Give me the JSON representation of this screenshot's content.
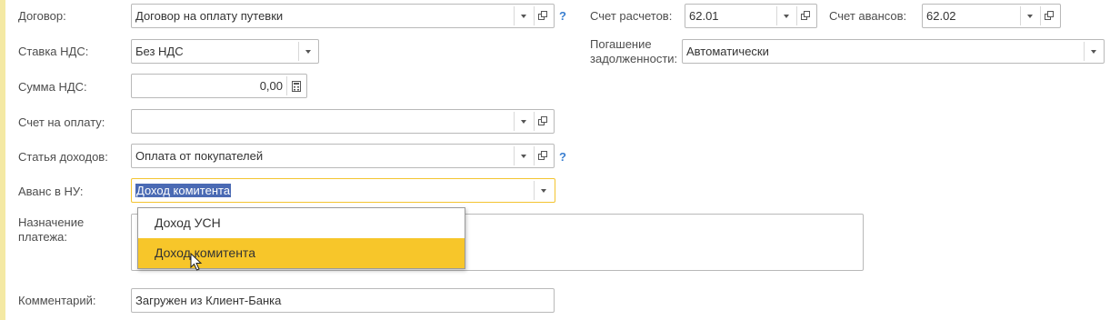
{
  "labels": {
    "contract": "Договор:",
    "vat_rate": "Ставка НДС:",
    "vat_sum": "Сумма НДС:",
    "invoice": "Счет на оплату:",
    "income_item": "Статья доходов:",
    "advance_nu": "Аванс в НУ:",
    "purpose": "Назначение платежа:",
    "comment": "Комментарий:",
    "settlement_account": "Счет расчетов:",
    "advance_account": "Счет авансов:",
    "debt_repayment": "Погашение задолженности:"
  },
  "fields": {
    "contract": "Договор на оплату путевки",
    "vat_rate": "Без НДС",
    "vat_sum": "0,00",
    "invoice": "",
    "income_item": "Оплата от покупателей",
    "advance_nu": "Доход комитента",
    "purpose": "",
    "comment": "Загружен из Клиент-Банка",
    "settlement_account": "62.01",
    "advance_account": "62.02",
    "debt_repayment": "Автоматически"
  },
  "help_mark": "?",
  "dropdown": {
    "items": [
      "Доход УСН",
      "Доход комитента"
    ],
    "highlighted": "Доход комитента"
  },
  "icons": {
    "dropdown": "chevron-down-icon",
    "open": "open-form-icon",
    "calculator": "calculator-icon",
    "help": "help-icon",
    "cursor": "mouse-pointer-icon"
  },
  "colors": {
    "accent": "#f7c62a",
    "focus_border": "#f4c430",
    "selection": "#4a6ab4",
    "help": "#3a7fd0"
  }
}
